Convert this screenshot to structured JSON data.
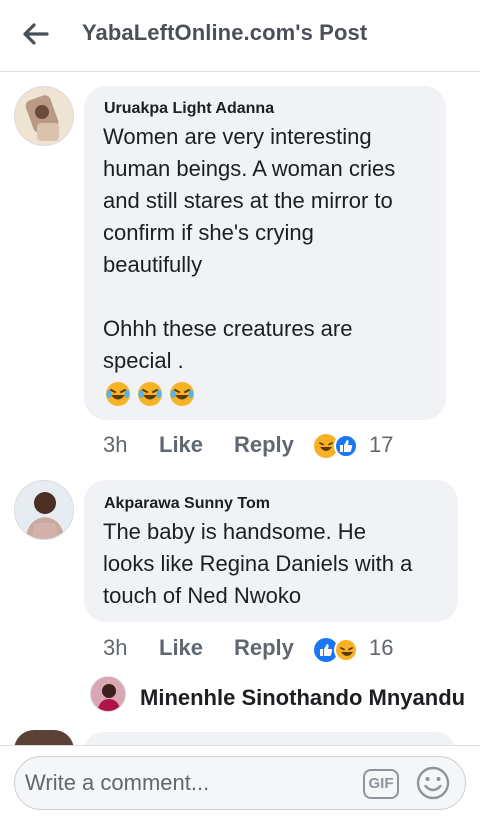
{
  "header": {
    "title": "YabaLeftOnline.com's Post"
  },
  "comments": [
    {
      "author": "Uruakpa Light Adanna",
      "lines": [
        "Women are very interesting",
        "human beings. A woman cries",
        "and still stares at the mirror to",
        "confirm if she's crying",
        "beautifully",
        "",
        "Ohhh these creatures are",
        "special ."
      ],
      "emojis": 3,
      "time": "3h",
      "like_label": "Like",
      "reply_label": "Reply",
      "reactions": [
        "haha",
        "like"
      ],
      "reaction_count": "17"
    },
    {
      "author": "Akparawa Sunny Tom",
      "lines": [
        "The baby is handsome. He",
        "looks like Regina Daniels with a",
        "touch of Ned Nwoko"
      ],
      "time": "3h",
      "like_label": "Like",
      "reply_label": "Reply",
      "reactions": [
        "like",
        "haha"
      ],
      "reaction_count": "16"
    }
  ],
  "reply_preview": {
    "name": "Minenhle Sinothando Mnyandu"
  },
  "composer": {
    "placeholder": "Write a comment...",
    "gif_label": "GIF"
  },
  "colors": {
    "bubble": "#f0f2f5",
    "like_blue": "#1877f2",
    "haha_yellow": "#f7b125"
  }
}
